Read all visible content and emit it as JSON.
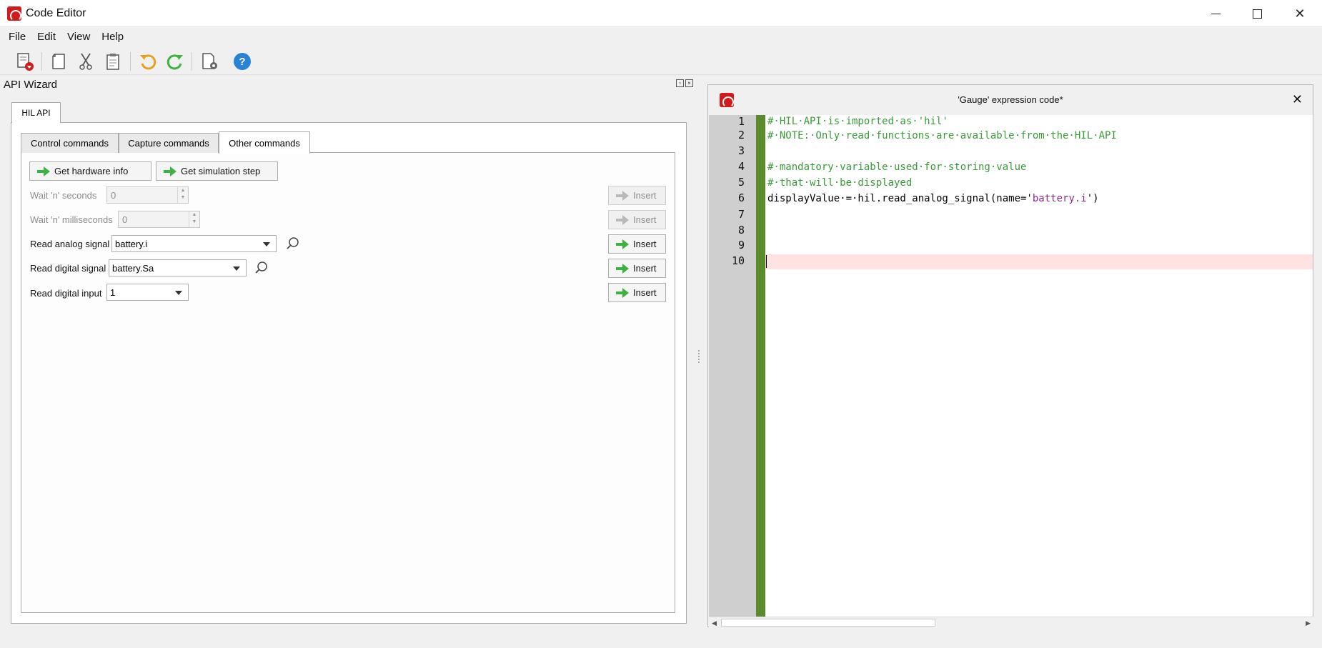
{
  "window": {
    "title": "Code Editor"
  },
  "menu": [
    "File",
    "Edit",
    "View",
    "Help"
  ],
  "panel": {
    "title": "API Wizard",
    "outer_tab": "HIL API",
    "inner_tabs": [
      "Control commands",
      "Capture commands",
      "Other commands"
    ],
    "active_inner_tab": "Other commands",
    "get_hardware_info": "Get hardware info",
    "get_simulation_step": "Get simulation step",
    "wait_seconds_label": "Wait 'n' seconds",
    "wait_seconds_value": "0",
    "wait_ms_label": "Wait 'n' milliseconds",
    "wait_ms_value": "0",
    "read_analog_label": "Read analog signal",
    "read_analog_value": "battery.i",
    "read_digital_label": "Read digital signal",
    "read_digital_value": "battery.Sa",
    "read_input_label": "Read digital input",
    "read_input_value": "1",
    "insert_label": "Insert"
  },
  "editor": {
    "title": "'Gauge' expression code*",
    "line_numbers": [
      "1",
      "2",
      "3",
      "4",
      "5",
      "6",
      "7",
      "8",
      "9",
      "10"
    ],
    "lines": {
      "l1": "#·HIL·API·is·imported·as·'hil'",
      "l2": "#·NOTE:·Only·read·functions·are·available·from·the·HIL·API",
      "l4": "#·mandatory·variable·used·for·storing·value",
      "l5": "#·that·will·be·displayed",
      "l6_pre": "displayValue·=·hil.read_analog_signal(name='",
      "l6_str": "battery.i",
      "l6_post": "')"
    },
    "current_line": "10"
  }
}
